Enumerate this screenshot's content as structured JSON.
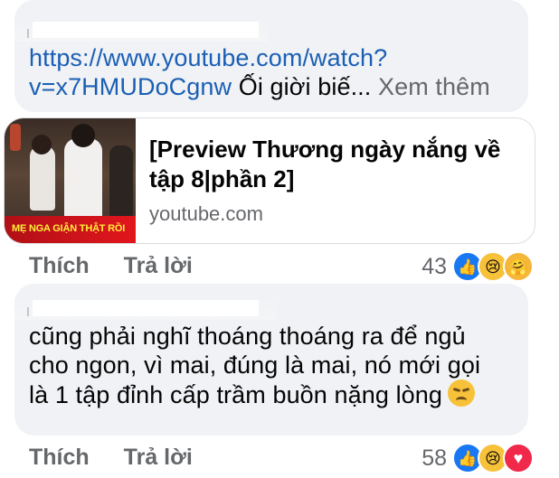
{
  "comment1": {
    "text_line1": "https://www.youtube.com/watch?",
    "text_line2_link": "v=x7HMUDoCgnw",
    "text_line2_rest": " Ối giời biế...",
    "see_more": "Xem thêm",
    "preview": {
      "thumbnail_caption": "MẸ NGA GIẬN THẬT RỒI",
      "title": "[Preview Thương ngày nắng về tập 8|phần 2]",
      "domain": "youtube.com"
    },
    "like_label": "Thích",
    "reply_label": "Trả lời",
    "reaction_count": "43",
    "reactions": [
      "like-icon",
      "sad-icon",
      "care-icon"
    ]
  },
  "comment2": {
    "text_line1": "cũng phải nghĩ thoáng thoáng ra để ngủ",
    "text_line2": "cho ngon, vì mai, đúng là mai, nó mới gọi",
    "text_line3": "là 1 tập đỉnh cấp trầm buồn nặng lòng",
    "trailing_emoji": "disappointed-face-emoji",
    "like_label": "Thích",
    "reply_label": "Trả lời",
    "reaction_count": "58",
    "reactions": [
      "like-icon",
      "sad-icon",
      "love-icon"
    ]
  },
  "colors": {
    "bubble": "#f0f2f5",
    "link": "#1a5fb4",
    "muted": "#65676b",
    "like": "#1877f2",
    "love": "#f02849",
    "sad": "#f7c23a"
  }
}
